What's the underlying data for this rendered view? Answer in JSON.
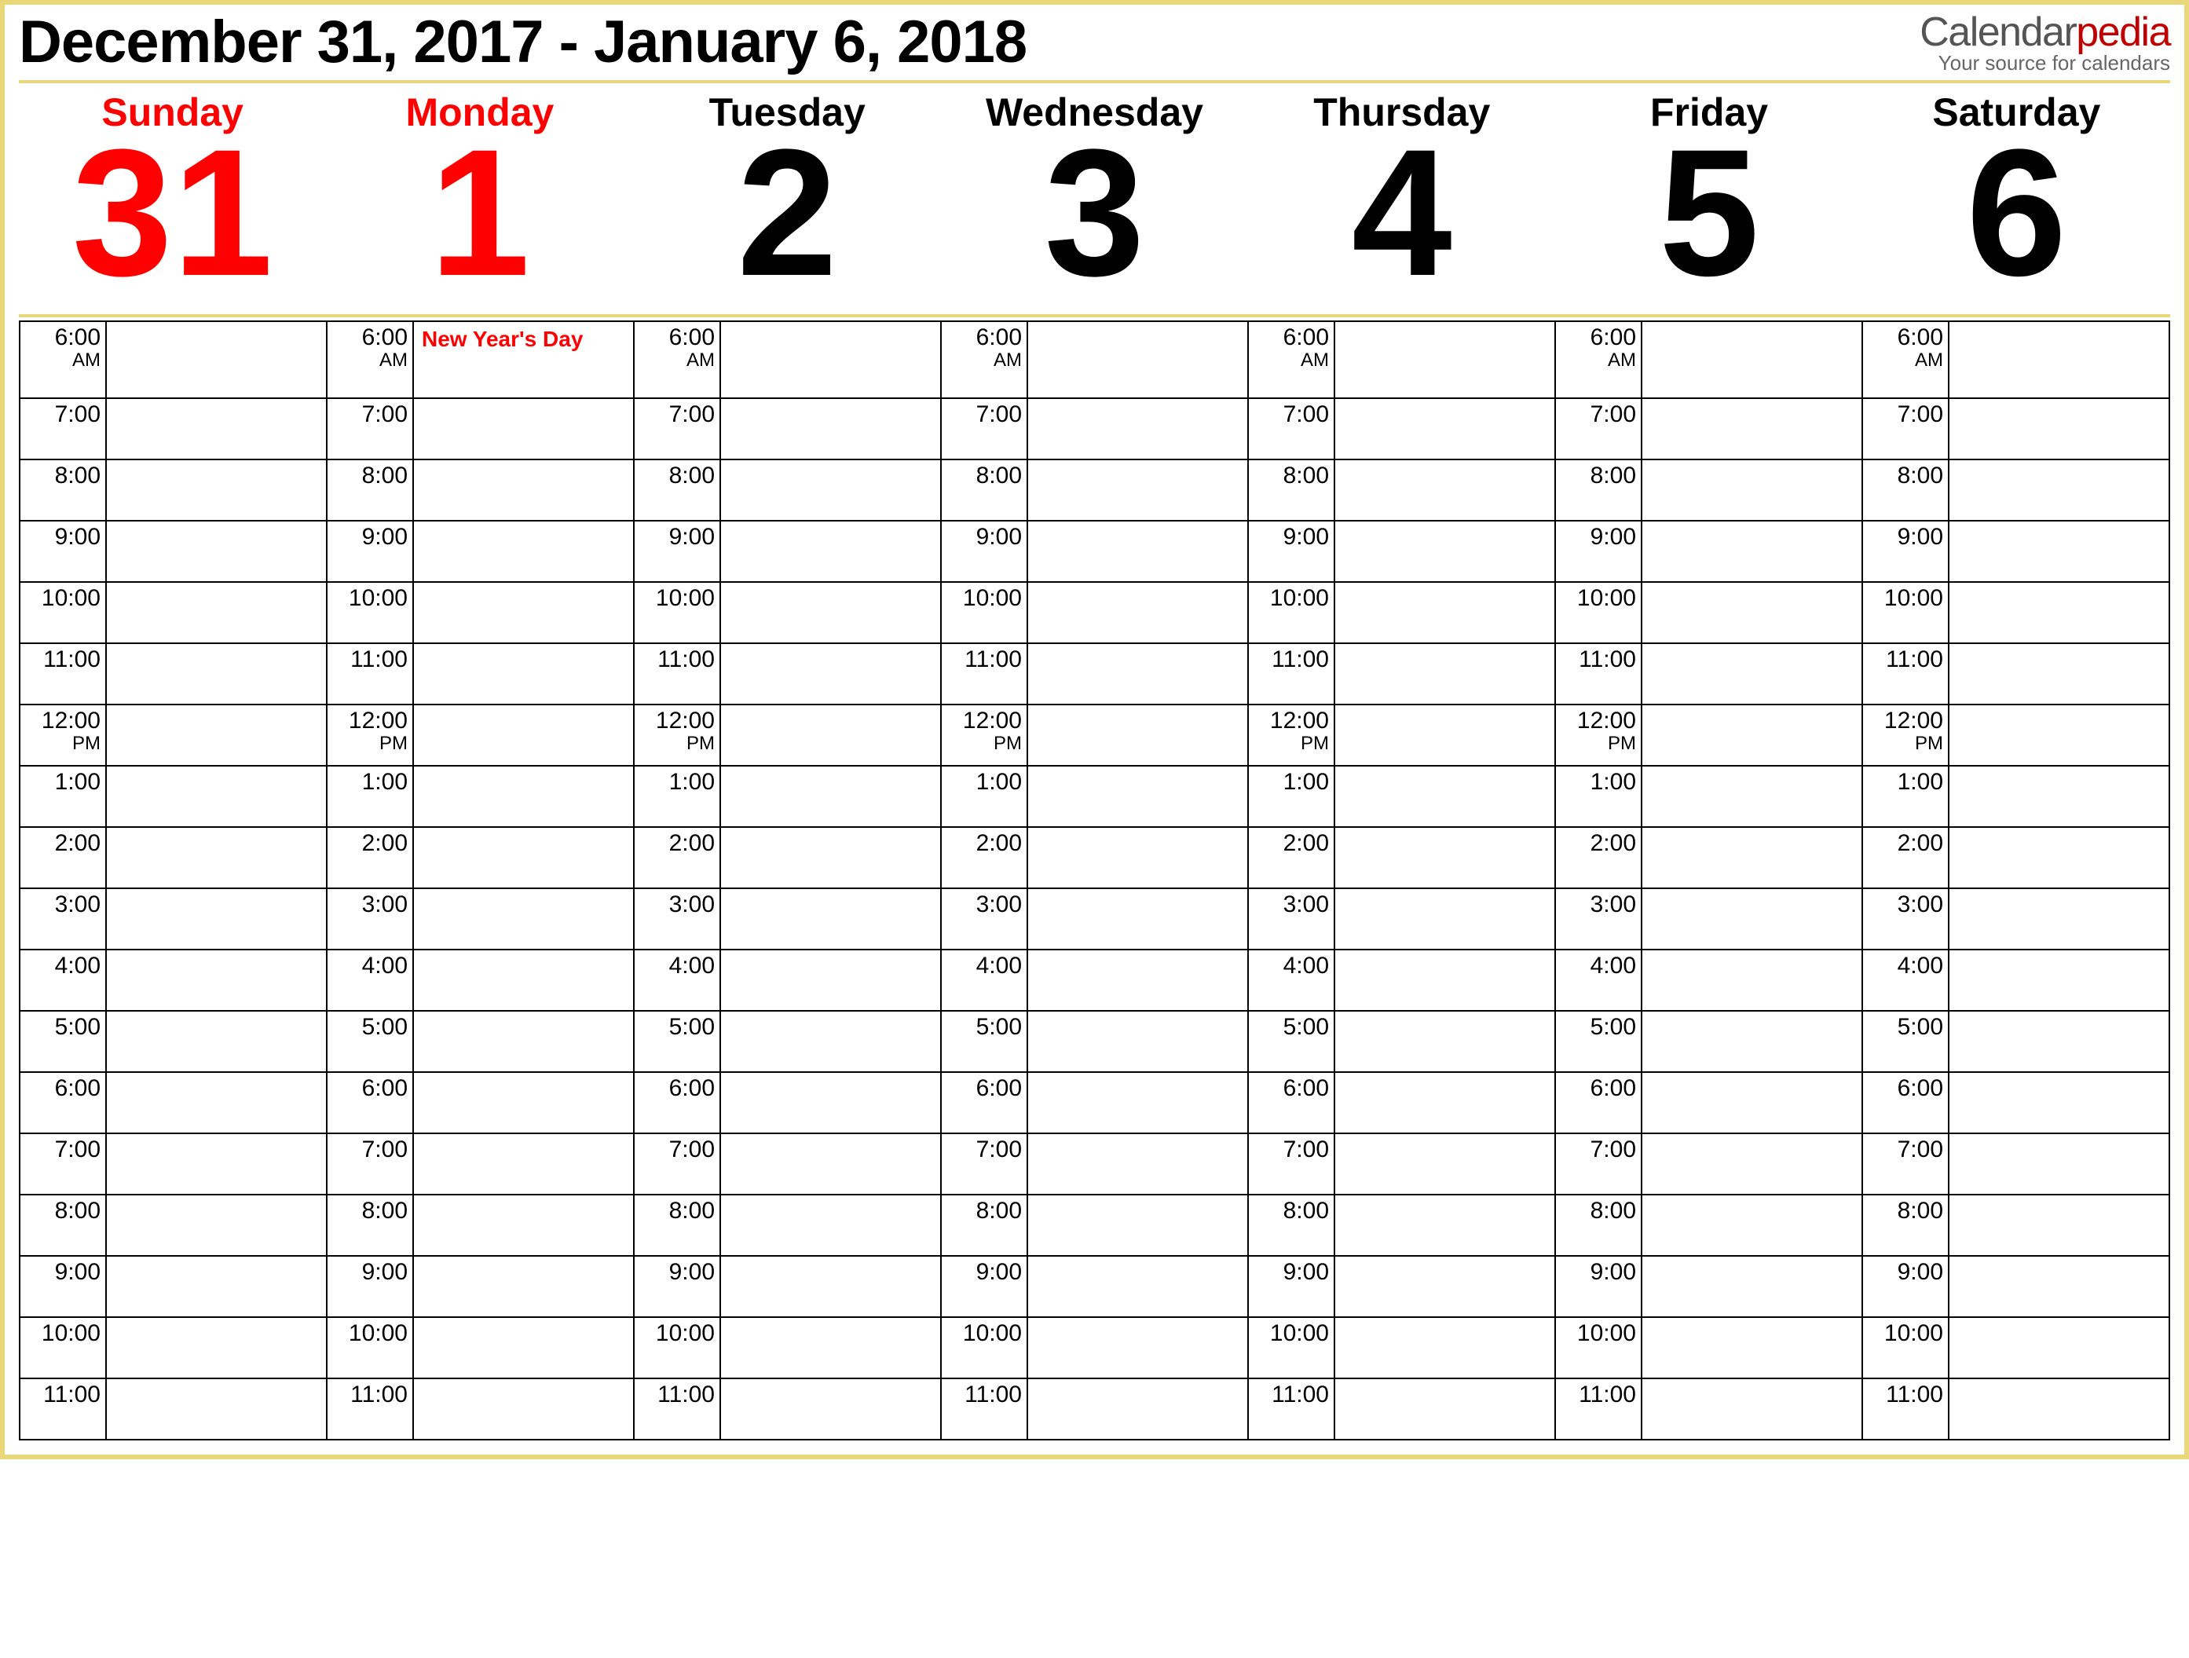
{
  "header": {
    "title": "December 31, 2017 - January 6, 2018",
    "brand_prefix": "Calendar",
    "brand_accent": "pedia",
    "brand_tagline": "Your source for calendars"
  },
  "days": [
    {
      "name": "Sunday",
      "number": "31",
      "highlight": true
    },
    {
      "name": "Monday",
      "number": "1",
      "highlight": true
    },
    {
      "name": "Tuesday",
      "number": "2",
      "highlight": false
    },
    {
      "name": "Wednesday",
      "number": "3",
      "highlight": false
    },
    {
      "name": "Thursday",
      "number": "4",
      "highlight": false
    },
    {
      "name": "Friday",
      "number": "5",
      "highlight": false
    },
    {
      "name": "Saturday",
      "number": "6",
      "highlight": false
    }
  ],
  "timeslots": [
    {
      "hour": "6:00",
      "suffix": "AM"
    },
    {
      "hour": "7:00",
      "suffix": ""
    },
    {
      "hour": "8:00",
      "suffix": ""
    },
    {
      "hour": "9:00",
      "suffix": ""
    },
    {
      "hour": "10:00",
      "suffix": ""
    },
    {
      "hour": "11:00",
      "suffix": ""
    },
    {
      "hour": "12:00",
      "suffix": "PM"
    },
    {
      "hour": "1:00",
      "suffix": ""
    },
    {
      "hour": "2:00",
      "suffix": ""
    },
    {
      "hour": "3:00",
      "suffix": ""
    },
    {
      "hour": "4:00",
      "suffix": ""
    },
    {
      "hour": "5:00",
      "suffix": ""
    },
    {
      "hour": "6:00",
      "suffix": ""
    },
    {
      "hour": "7:00",
      "suffix": ""
    },
    {
      "hour": "8:00",
      "suffix": ""
    },
    {
      "hour": "9:00",
      "suffix": ""
    },
    {
      "hour": "10:00",
      "suffix": ""
    },
    {
      "hour": "11:00",
      "suffix": ""
    }
  ],
  "events": {
    "0": {
      "1": "New Year's Day"
    }
  }
}
